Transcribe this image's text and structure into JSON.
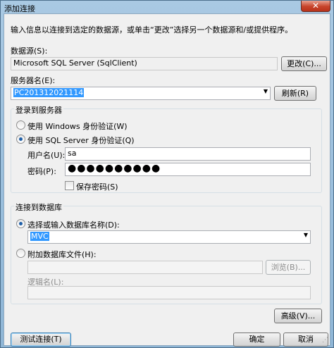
{
  "window": {
    "title": "添加连接",
    "close_glyph": "✕"
  },
  "intro_text": "输入信息以连接到选定的数据源，或单击“更改”选择另一个数据源和/或提供程序。",
  "datasource": {
    "label": "数据源(S):",
    "value": "Microsoft SQL Server (SqlClient)",
    "change_button": "更改(C)..."
  },
  "server": {
    "label": "服务器名(E):",
    "value": "PC201312021114",
    "refresh_button": "刷新(R)"
  },
  "login_group": {
    "title": "登录到服务器",
    "windows_auth": "使用 Windows 身份验证(W)",
    "sql_auth": "使用 SQL Server 身份验证(Q)",
    "username_label": "用户名(U):",
    "username_value": "sa",
    "password_label": "密码(P):",
    "password_value": "●●●●●●●●●●",
    "save_password": "保存密码(S)"
  },
  "db_group": {
    "title": "连接到数据库",
    "select_db": "选择或输入数据库名称(D):",
    "db_value": "MVC",
    "attach_db": "附加数据库文件(H):",
    "browse_button": "浏览(B)...",
    "logical_name_label": "逻辑名(L):"
  },
  "footer": {
    "advanced_button": "高级(V)...",
    "test_button": "测试连接(T)",
    "ok_button": "确定",
    "cancel_button": "取消"
  }
}
